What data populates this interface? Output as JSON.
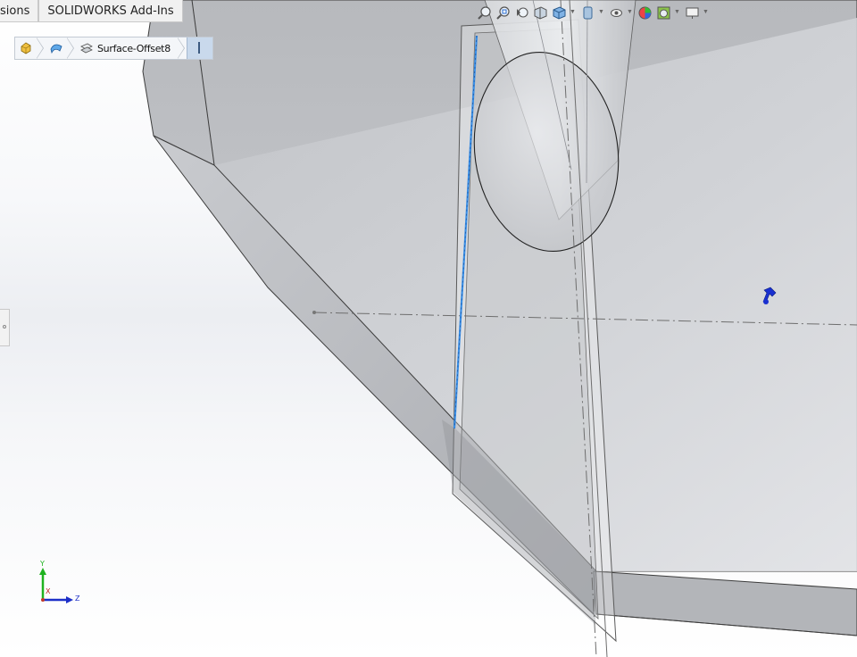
{
  "command_tabs": [
    "sions",
    "SOLIDWORKS Add-Ins"
  ],
  "breadcrumb": {
    "items": [
      {
        "icon": "part-icon"
      },
      {
        "icon": "surface-feature-icon"
      },
      {
        "icon": "surface-offset-icon",
        "label": "Surface-Offset8"
      }
    ],
    "selection_indicator": "edge-selection-icon"
  },
  "view_toolbar": {
    "tools": [
      {
        "icon": "zoom-to-fit-icon"
      },
      {
        "icon": "zoom-to-area-icon"
      },
      {
        "icon": "previous-view-icon"
      },
      {
        "icon": "section-view-icon"
      },
      {
        "icon": "view-orientation-icon",
        "has_menu": true
      },
      {
        "icon": "display-style-icon",
        "has_menu": true
      },
      {
        "icon": "hide-show-items-icon",
        "has_menu": true
      },
      {
        "icon": "edit-appearance-icon"
      },
      {
        "icon": "apply-scene-icon",
        "has_menu": true
      },
      {
        "icon": "view-settings-icon",
        "has_menu": true
      }
    ]
  },
  "triad": {
    "y_label": "Y",
    "x_label": "X",
    "z_label": "Z"
  },
  "colors": {
    "selected_edge": "#3a8fe6",
    "y_axis": "#1fb21f",
    "z_axis": "#1c2fc8",
    "accent": "#2b6fd6"
  }
}
